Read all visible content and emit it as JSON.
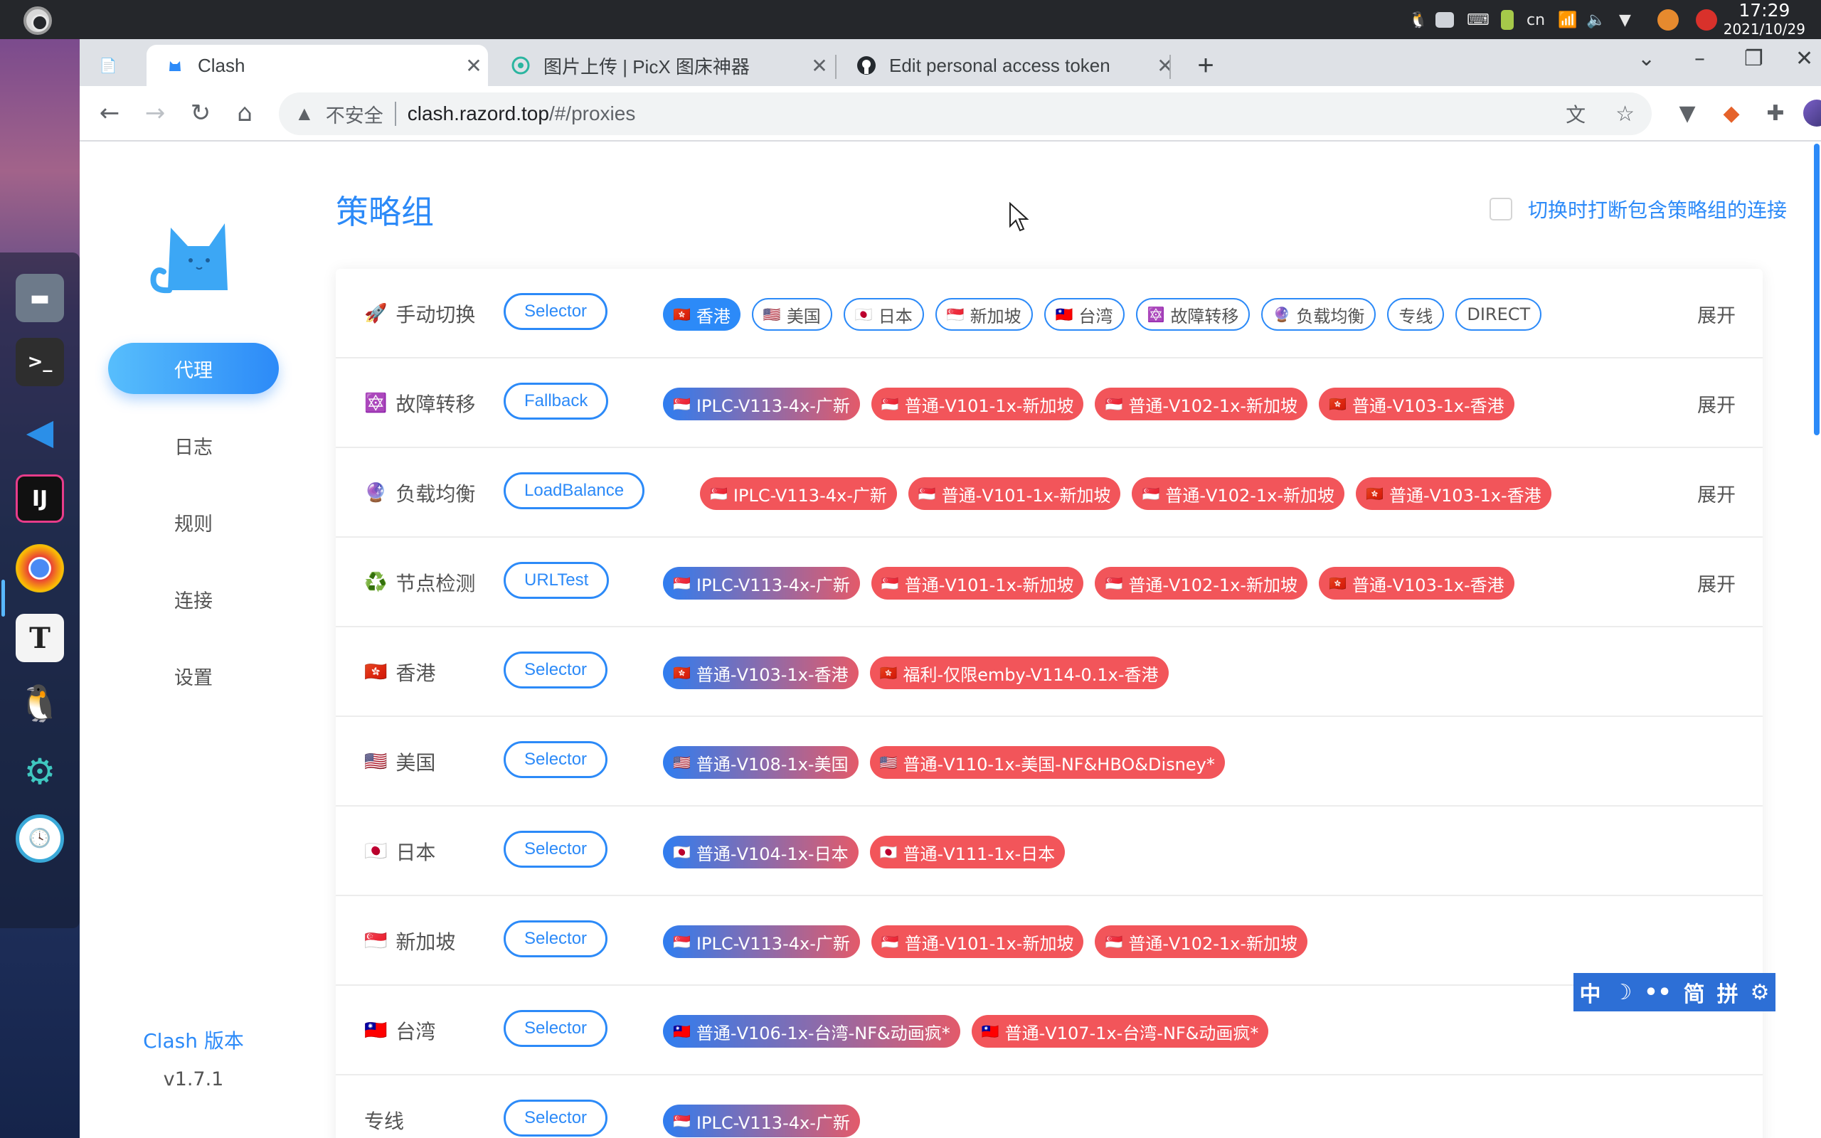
{
  "os": {
    "time": "17:29",
    "date": "2021/10/29",
    "keyboard_lang": "cn"
  },
  "browser": {
    "tabs": [
      {
        "title": "",
        "icon": "pinned-page-icon"
      },
      {
        "title": "Clash",
        "icon": "clash-cat-icon"
      },
      {
        "title": "图片上传 | PicX 图床神器",
        "icon": "picx-icon"
      },
      {
        "title": "Edit personal access token",
        "icon": "github-icon"
      }
    ],
    "address": {
      "security_label": "不安全",
      "host": "clash.razord.top",
      "path": "/#/proxies"
    }
  },
  "sidebar": {
    "items": [
      "代理",
      "日志",
      "规则",
      "连接",
      "设置"
    ],
    "version_label": "Clash 版本",
    "version": "v1.7.1"
  },
  "main": {
    "title": "策略组",
    "break_connections_label": "切换时打断包含策略组的连接",
    "expand_label": "展开",
    "groups": [
      {
        "emoji": "🚀",
        "name": "手动切换",
        "type": "Selector",
        "expand": true,
        "proxies": [
          {
            "flag": "🇭🇰",
            "name": "香港",
            "selected": true
          },
          {
            "flag": "🇺🇸",
            "name": "美国"
          },
          {
            "flag": "🇯🇵",
            "name": "日本"
          },
          {
            "flag": "🇸🇬",
            "name": "新加坡"
          },
          {
            "flag": "🇹🇼",
            "name": "台湾"
          },
          {
            "flag": "🔯",
            "name": "故障转移"
          },
          {
            "flag": "🔮",
            "name": "负载均衡"
          },
          {
            "flag": "",
            "name": "专线"
          },
          {
            "flag": "",
            "name": "DIRECT"
          }
        ]
      },
      {
        "emoji": "🔯",
        "name": "故障转移",
        "type": "Fallback",
        "expand": true,
        "proxies": [
          {
            "flag": "🇸🇬",
            "name": "IPLC-V113-4x-广新",
            "selected": true
          },
          {
            "flag": "🇸🇬",
            "name": "普通-V101-1x-新加坡"
          },
          {
            "flag": "🇸🇬",
            "name": "普通-V102-1x-新加坡"
          },
          {
            "flag": "🇭🇰",
            "name": "普通-V103-1x-香港"
          }
        ]
      },
      {
        "emoji": "🔮",
        "name": "负载均衡",
        "type": "LoadBalance",
        "expand": true,
        "proxies": [
          {
            "flag": "🇸🇬",
            "name": "IPLC-V113-4x-广新"
          },
          {
            "flag": "🇸🇬",
            "name": "普通-V101-1x-新加坡"
          },
          {
            "flag": "🇸🇬",
            "name": "普通-V102-1x-新加坡"
          },
          {
            "flag": "🇭🇰",
            "name": "普通-V103-1x-香港"
          }
        ]
      },
      {
        "emoji": "♻️",
        "name": "节点检测",
        "type": "URLTest",
        "expand": true,
        "proxies": [
          {
            "flag": "🇸🇬",
            "name": "IPLC-V113-4x-广新",
            "selected": true
          },
          {
            "flag": "🇸🇬",
            "name": "普通-V101-1x-新加坡"
          },
          {
            "flag": "🇸🇬",
            "name": "普通-V102-1x-新加坡"
          },
          {
            "flag": "🇭🇰",
            "name": "普通-V103-1x-香港"
          }
        ]
      },
      {
        "emoji": "🇭🇰",
        "name": "香港",
        "type": "Selector",
        "expand": false,
        "proxies": [
          {
            "flag": "🇭🇰",
            "name": "普通-V103-1x-香港",
            "selected": true
          },
          {
            "flag": "🇭🇰",
            "name": "福利-仅限emby-V114-0.1x-香港"
          }
        ]
      },
      {
        "emoji": "🇺🇸",
        "name": "美国",
        "type": "Selector",
        "expand": false,
        "proxies": [
          {
            "flag": "🇺🇸",
            "name": "普通-V108-1x-美国",
            "selected": true
          },
          {
            "flag": "🇺🇸",
            "name": "普通-V110-1x-美国-NF&HBO&Disney*"
          }
        ]
      },
      {
        "emoji": "🇯🇵",
        "name": "日本",
        "type": "Selector",
        "expand": false,
        "proxies": [
          {
            "flag": "🇯🇵",
            "name": "普通-V104-1x-日本",
            "selected": true
          },
          {
            "flag": "🇯🇵",
            "name": "普通-V111-1x-日本"
          }
        ]
      },
      {
        "emoji": "🇸🇬",
        "name": "新加坡",
        "type": "Selector",
        "expand": false,
        "proxies": [
          {
            "flag": "🇸🇬",
            "name": "IPLC-V113-4x-广新",
            "selected": true
          },
          {
            "flag": "🇸🇬",
            "name": "普通-V101-1x-新加坡"
          },
          {
            "flag": "🇸🇬",
            "name": "普通-V102-1x-新加坡"
          }
        ]
      },
      {
        "emoji": "🇹🇼",
        "name": "台湾",
        "type": "Selector",
        "expand": false,
        "proxies": [
          {
            "flag": "🇹🇼",
            "name": "普通-V106-1x-台湾-NF&动画疯*",
            "selected": true
          },
          {
            "flag": "🇹🇼",
            "name": "普通-V107-1x-台湾-NF&动画疯*"
          }
        ]
      },
      {
        "emoji": "",
        "name": "专线",
        "type": "Selector",
        "expand": false,
        "proxies": [
          {
            "flag": "🇸🇬",
            "name": "IPLC-V113-4x-广新",
            "selected": true
          }
        ]
      }
    ]
  },
  "ime": {
    "items": [
      "中",
      "☽",
      "••",
      "简",
      "拼",
      "⚙"
    ]
  },
  "colors": {
    "accent": "#2c8af8",
    "proxy_fill": "#f2555a",
    "text": "#545454"
  }
}
